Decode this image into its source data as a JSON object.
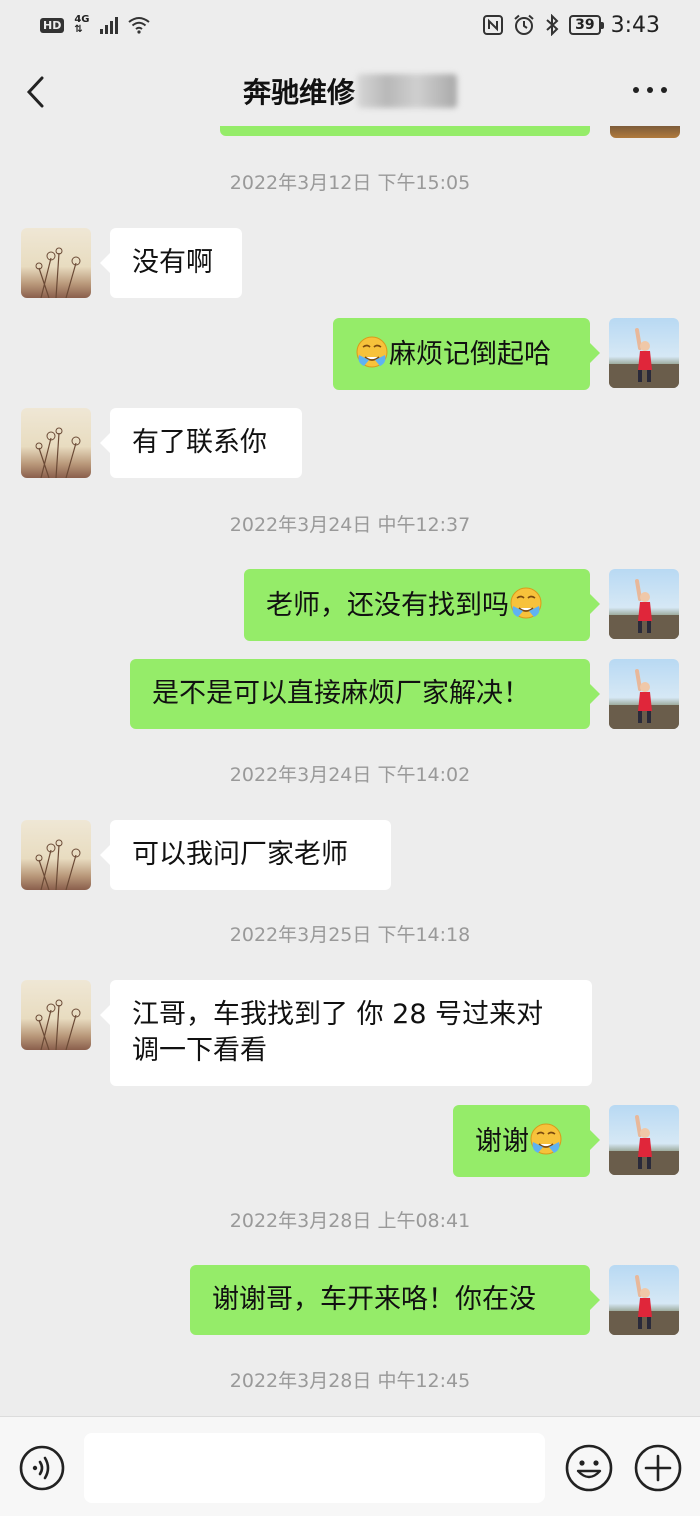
{
  "status_bar": {
    "hd": "HD",
    "network": "4G",
    "battery": "39",
    "time": "3:43"
  },
  "header": {
    "title": "奔驰维修",
    "back_icon": "chevron-left-icon",
    "more_icon": "more-horizontal-icon"
  },
  "messages": [
    {
      "type": "time",
      "text": "2022年3月12日 下午15:05"
    },
    {
      "type": "msg",
      "side": "left",
      "text": "没有啊"
    },
    {
      "type": "msg",
      "side": "right",
      "text": "麻烦记倒起哈",
      "emoji": "facepalm-emoji",
      "emoji_pos": "before"
    },
    {
      "type": "msg",
      "side": "left",
      "text": "有了联系你"
    },
    {
      "type": "time",
      "text": "2022年3月24日 中午12:37"
    },
    {
      "type": "msg",
      "side": "right",
      "text": "老师，还没有找到吗",
      "emoji": "facepalm-emoji",
      "emoji_pos": "after"
    },
    {
      "type": "msg",
      "side": "right",
      "text": "是不是可以直接麻烦厂家解决！"
    },
    {
      "type": "time",
      "text": "2022年3月24日 下午14:02"
    },
    {
      "type": "msg",
      "side": "left",
      "text": "可以我问厂家老师"
    },
    {
      "type": "time",
      "text": "2022年3月25日 下午14:18"
    },
    {
      "type": "msg",
      "side": "left",
      "text": "江哥，车我找到了 你 28 号过来对调一下看看"
    },
    {
      "type": "msg",
      "side": "right",
      "text": "谢谢",
      "emoji": "facepalm-emoji",
      "emoji_pos": "after"
    },
    {
      "type": "time",
      "text": "2022年3月28日 上午08:41"
    },
    {
      "type": "msg",
      "side": "right",
      "text": "谢谢哥，车开来咯！你在没"
    },
    {
      "type": "time",
      "text": "2022年3月28日 中午12:45"
    }
  ],
  "input_bar": {
    "voice_icon": "voice-icon",
    "input_value": "",
    "emoji_icon": "smiley-icon",
    "plus_icon": "plus-circle-icon"
  },
  "colors": {
    "background": "#ededed",
    "self_bubble": "#95ec69",
    "other_bubble": "#ffffff",
    "timestamp": "#999999"
  }
}
